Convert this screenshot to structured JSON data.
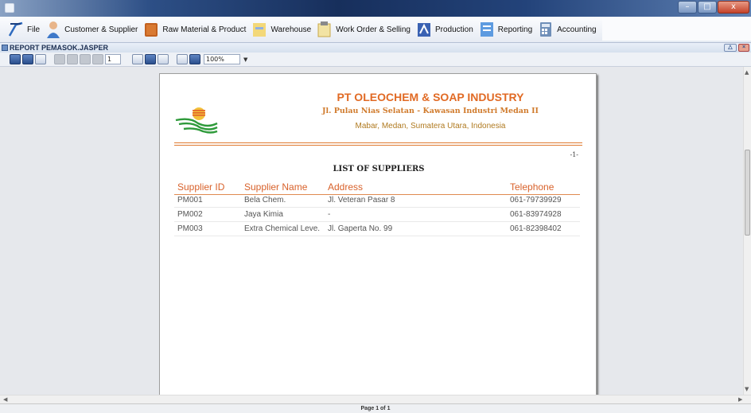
{
  "window": {
    "minimize_symbol": "–",
    "restore_symbol": "□",
    "close_symbol": "x"
  },
  "menu": {
    "items": [
      {
        "label": "File",
        "icon": "file-icon"
      },
      {
        "label": "Customer & Supplier",
        "icon": "customer-icon"
      },
      {
        "label": "Raw Material & Product",
        "icon": "raw-material-icon"
      },
      {
        "label": "Warehouse",
        "icon": "warehouse-icon"
      },
      {
        "label": "Work Order & Selling",
        "icon": "work-order-icon"
      },
      {
        "label": "Production",
        "icon": "production-icon"
      },
      {
        "label": "Reporting",
        "icon": "reporting-icon"
      },
      {
        "label": "Accounting",
        "icon": "accounting-icon"
      }
    ]
  },
  "internal_frame": {
    "title": "REPORT PEMASOK.JASPER"
  },
  "toolbar": {
    "page_number": "1",
    "zoom": "100%"
  },
  "report": {
    "company_name": "PT OLEOCHEM & SOAP INDUSTRY",
    "address_line1": "Jl. Pulau Nias Selatan - Kawasan Industri Medan II",
    "address_line2": "Mabar, Medan, Sumatera Utara, Indonesia",
    "page_marker": "-1-",
    "title": "LIST OF SUPPLIERS",
    "columns": [
      "Supplier ID",
      "Supplier Name",
      "Address",
      "Telephone"
    ],
    "rows": [
      [
        "PM001",
        "Bela Chem.",
        "Jl. Veteran Pasar 8",
        "061-79739929"
      ],
      [
        "PM002",
        "Jaya Kimia",
        "-",
        "061-83974928"
      ],
      [
        "PM003",
        "Extra Chemical Leve.",
        "Jl. Gaperta No. 99",
        "061-82398402"
      ]
    ]
  },
  "status": {
    "page_info": "Page 1 of 1"
  },
  "colors": {
    "accent": "#e16a24",
    "title_bar": "#23437a"
  }
}
